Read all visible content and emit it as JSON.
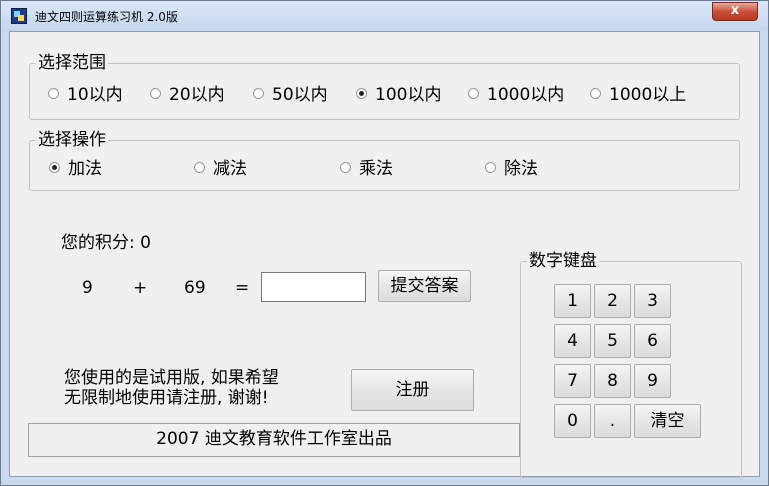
{
  "window": {
    "title": "迪文四则运算练习机  2.0版",
    "close_label": "x"
  },
  "range_group": {
    "legend": "选择范围",
    "options": [
      {
        "label": "10以内",
        "checked": false
      },
      {
        "label": "20以内",
        "checked": false
      },
      {
        "label": "50以内",
        "checked": false
      },
      {
        "label": "100以内",
        "checked": true
      },
      {
        "label": "1000以内",
        "checked": false
      },
      {
        "label": "1000以上",
        "checked": false
      }
    ]
  },
  "operation_group": {
    "legend": "选择操作",
    "options": [
      {
        "label": "加法",
        "checked": true
      },
      {
        "label": "减法",
        "checked": false
      },
      {
        "label": "乘法",
        "checked": false
      },
      {
        "label": "除法",
        "checked": false
      }
    ]
  },
  "score": {
    "text": "您的积分: 0"
  },
  "problem": {
    "operand1": "9",
    "operator": "+",
    "operand2": "69",
    "equals": "=",
    "answer_value": ""
  },
  "submit_label": "提交答案",
  "trial_notice": {
    "line1": "您使用的是试用版, 如果希望",
    "line2": "无限制地使用请注册, 谢谢!"
  },
  "register_label": "注册",
  "footer_text": "2007  迪文教育软件工作室出品",
  "keypad": {
    "legend": "数字键盘",
    "keys": [
      "1",
      "2",
      "3",
      "4",
      "5",
      "6",
      "7",
      "8",
      "9",
      "0",
      "."
    ],
    "clear_label": "清空"
  }
}
